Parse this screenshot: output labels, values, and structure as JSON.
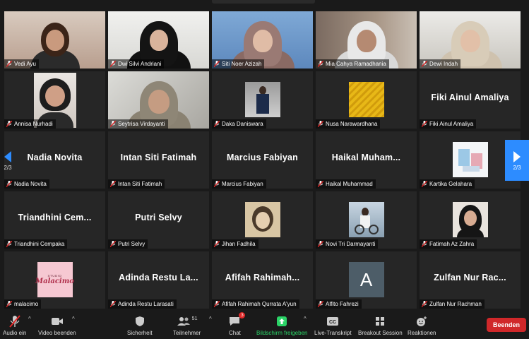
{
  "participants": [
    {
      "name": "Vedi Ayu"
    },
    {
      "name": "Dwi Silvi Andriani"
    },
    {
      "name": "Siti Noer Azizah"
    },
    {
      "name": "Mia Cahya Ramadhania"
    },
    {
      "name": "Dewi Indah"
    },
    {
      "name": "Annisa Nurhadi"
    },
    {
      "name": "Seytrisa Virdayanti"
    },
    {
      "name": "Daka Daniswara"
    },
    {
      "name": "Nusa Narawardhana"
    },
    {
      "name": "Fiki Ainul Amaliya",
      "display": "Fiki Ainul Amaliya"
    },
    {
      "name": "Nadia Novita",
      "display": "Nadia Novita"
    },
    {
      "name": "Intan Siti Fatimah",
      "display": "Intan Siti Fatimah"
    },
    {
      "name": "Marcius Fabiyan",
      "display": "Marcius Fabiyan"
    },
    {
      "name": "Haikal Muhammad",
      "display": "Haikal  Muham..."
    },
    {
      "name": "Kartika Gelahara"
    },
    {
      "name": "Triandhini Cempaka",
      "display": "Triandhini  Cem..."
    },
    {
      "name": "Putri Selvy",
      "display": "Putri Selvy"
    },
    {
      "name": "Jihan Fadhila"
    },
    {
      "name": "Novi Tri Darmayanti"
    },
    {
      "name": "Fatimah Az Zahra"
    },
    {
      "name": "malacimo",
      "logo_top": "STUDIO",
      "logo_text": "Malacimo"
    },
    {
      "name": "Adinda Restu Larasati",
      "display": "Adinda Restu La..."
    },
    {
      "name": "Afifah Rahimah Qurrata A'yun",
      "display": "Afifah  Rahimah..."
    },
    {
      "name": "Alfito Fahrezi",
      "avatar_letter": "A"
    },
    {
      "name": "Zulfan Nur Rachman",
      "display": "Zulfan Nur Rac..."
    }
  ],
  "pagination": {
    "left": "2/3",
    "right": "2/3"
  },
  "toolbar": {
    "audio": "Audio ein",
    "video": "Video beenden",
    "security": "Sicherheit",
    "participants": "Teilnehmer",
    "participants_count": "51",
    "chat": "Chat",
    "chat_badge": "3",
    "share": "Bildschirm freigeben",
    "transcript": "Live-Transkript",
    "breakout": "Breakout Session",
    "reactions": "Reaktionen",
    "end": "Beenden"
  },
  "colors": {
    "accent_blue": "#2d8cff",
    "share_green": "#2bd467",
    "end_red": "#d0282a",
    "mute_red": "#e02828"
  }
}
